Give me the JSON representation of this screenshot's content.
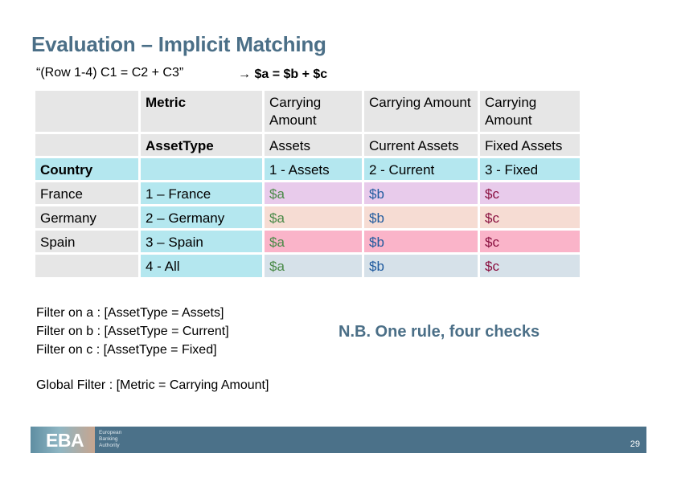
{
  "slide": {
    "title": "Evaluation – Implicit Matching",
    "subtitle": "“(Row 1-4) C1 = C2 + C3”",
    "formula": "→ $a = $b + $c"
  },
  "table": {
    "header_metric": {
      "label": "Metric",
      "values": [
        "Carrying Amount",
        "Carrying Amount",
        "Carrying Amount"
      ]
    },
    "header_assettype": {
      "label": "AssetType",
      "values": [
        "Assets",
        "Current Assets",
        "Fixed Assets"
      ]
    },
    "header_country": {
      "label": "Country",
      "codes": [
        "1 - Assets",
        "2 - Current",
        "3 - Fixed"
      ]
    },
    "rows": [
      {
        "country": "France",
        "code": "1 – France",
        "a": "$a",
        "b": "$b",
        "c": "$c"
      },
      {
        "country": "Germany",
        "code": "2 – Germany",
        "a": "$a",
        "b": "$b",
        "c": "$c"
      },
      {
        "country": "Spain",
        "code": "3 – Spain",
        "a": "$a",
        "b": "$b",
        "c": "$c"
      },
      {
        "country": "",
        "code": "4 -  All",
        "a": "$a",
        "b": "$b",
        "c": "$c"
      }
    ]
  },
  "filters": [
    "Filter on a : [AssetType = Assets]",
    "Filter on b : [AssetType = Current]",
    "Filter on c : [AssetType = Fixed]"
  ],
  "global_filter": "Global Filter : [Metric = Carrying Amount]",
  "note": "N.B. One rule, four checks",
  "footer": {
    "logo": "EBA",
    "org_lines": [
      "European",
      "Banking",
      "Authority"
    ],
    "page_number": "29"
  },
  "colors": {
    "accent": "#4b6f87",
    "footer_bar": "#4b7189",
    "value_a": "#4a8a48",
    "value_b": "#1f5a9e",
    "value_c": "#8a1040"
  }
}
